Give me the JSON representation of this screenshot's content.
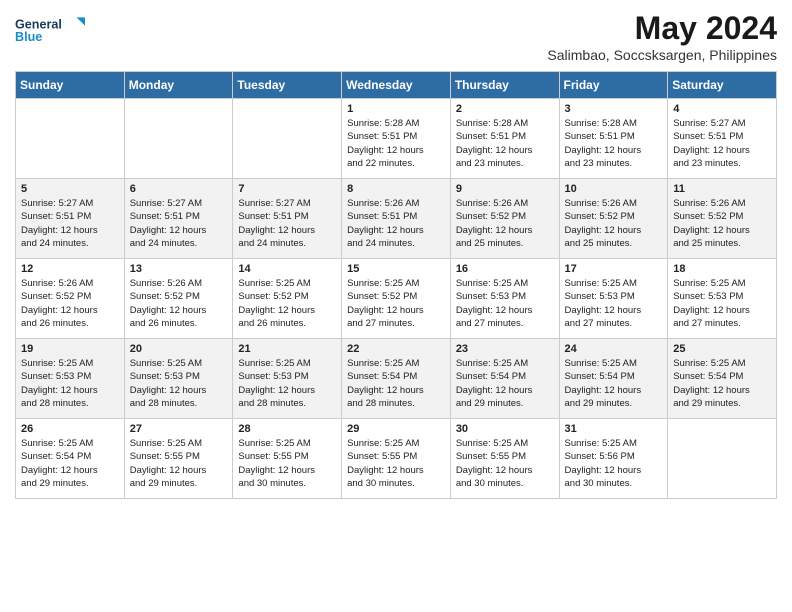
{
  "logo": {
    "line1": "General",
    "line2": "Blue"
  },
  "title": "May 2024",
  "subtitle": "Salimbao, Soccsksargen, Philippines",
  "weekdays": [
    "Sunday",
    "Monday",
    "Tuesday",
    "Wednesday",
    "Thursday",
    "Friday",
    "Saturday"
  ],
  "weeks": [
    [
      {
        "day": "",
        "info": ""
      },
      {
        "day": "",
        "info": ""
      },
      {
        "day": "",
        "info": ""
      },
      {
        "day": "1",
        "info": "Sunrise: 5:28 AM\nSunset: 5:51 PM\nDaylight: 12 hours\nand 22 minutes."
      },
      {
        "day": "2",
        "info": "Sunrise: 5:28 AM\nSunset: 5:51 PM\nDaylight: 12 hours\nand 23 minutes."
      },
      {
        "day": "3",
        "info": "Sunrise: 5:28 AM\nSunset: 5:51 PM\nDaylight: 12 hours\nand 23 minutes."
      },
      {
        "day": "4",
        "info": "Sunrise: 5:27 AM\nSunset: 5:51 PM\nDaylight: 12 hours\nand 23 minutes."
      }
    ],
    [
      {
        "day": "5",
        "info": "Sunrise: 5:27 AM\nSunset: 5:51 PM\nDaylight: 12 hours\nand 24 minutes."
      },
      {
        "day": "6",
        "info": "Sunrise: 5:27 AM\nSunset: 5:51 PM\nDaylight: 12 hours\nand 24 minutes."
      },
      {
        "day": "7",
        "info": "Sunrise: 5:27 AM\nSunset: 5:51 PM\nDaylight: 12 hours\nand 24 minutes."
      },
      {
        "day": "8",
        "info": "Sunrise: 5:26 AM\nSunset: 5:51 PM\nDaylight: 12 hours\nand 24 minutes."
      },
      {
        "day": "9",
        "info": "Sunrise: 5:26 AM\nSunset: 5:52 PM\nDaylight: 12 hours\nand 25 minutes."
      },
      {
        "day": "10",
        "info": "Sunrise: 5:26 AM\nSunset: 5:52 PM\nDaylight: 12 hours\nand 25 minutes."
      },
      {
        "day": "11",
        "info": "Sunrise: 5:26 AM\nSunset: 5:52 PM\nDaylight: 12 hours\nand 25 minutes."
      }
    ],
    [
      {
        "day": "12",
        "info": "Sunrise: 5:26 AM\nSunset: 5:52 PM\nDaylight: 12 hours\nand 26 minutes."
      },
      {
        "day": "13",
        "info": "Sunrise: 5:26 AM\nSunset: 5:52 PM\nDaylight: 12 hours\nand 26 minutes."
      },
      {
        "day": "14",
        "info": "Sunrise: 5:25 AM\nSunset: 5:52 PM\nDaylight: 12 hours\nand 26 minutes."
      },
      {
        "day": "15",
        "info": "Sunrise: 5:25 AM\nSunset: 5:52 PM\nDaylight: 12 hours\nand 27 minutes."
      },
      {
        "day": "16",
        "info": "Sunrise: 5:25 AM\nSunset: 5:53 PM\nDaylight: 12 hours\nand 27 minutes."
      },
      {
        "day": "17",
        "info": "Sunrise: 5:25 AM\nSunset: 5:53 PM\nDaylight: 12 hours\nand 27 minutes."
      },
      {
        "day": "18",
        "info": "Sunrise: 5:25 AM\nSunset: 5:53 PM\nDaylight: 12 hours\nand 27 minutes."
      }
    ],
    [
      {
        "day": "19",
        "info": "Sunrise: 5:25 AM\nSunset: 5:53 PM\nDaylight: 12 hours\nand 28 minutes."
      },
      {
        "day": "20",
        "info": "Sunrise: 5:25 AM\nSunset: 5:53 PM\nDaylight: 12 hours\nand 28 minutes."
      },
      {
        "day": "21",
        "info": "Sunrise: 5:25 AM\nSunset: 5:53 PM\nDaylight: 12 hours\nand 28 minutes."
      },
      {
        "day": "22",
        "info": "Sunrise: 5:25 AM\nSunset: 5:54 PM\nDaylight: 12 hours\nand 28 minutes."
      },
      {
        "day": "23",
        "info": "Sunrise: 5:25 AM\nSunset: 5:54 PM\nDaylight: 12 hours\nand 29 minutes."
      },
      {
        "day": "24",
        "info": "Sunrise: 5:25 AM\nSunset: 5:54 PM\nDaylight: 12 hours\nand 29 minutes."
      },
      {
        "day": "25",
        "info": "Sunrise: 5:25 AM\nSunset: 5:54 PM\nDaylight: 12 hours\nand 29 minutes."
      }
    ],
    [
      {
        "day": "26",
        "info": "Sunrise: 5:25 AM\nSunset: 5:54 PM\nDaylight: 12 hours\nand 29 minutes."
      },
      {
        "day": "27",
        "info": "Sunrise: 5:25 AM\nSunset: 5:55 PM\nDaylight: 12 hours\nand 29 minutes."
      },
      {
        "day": "28",
        "info": "Sunrise: 5:25 AM\nSunset: 5:55 PM\nDaylight: 12 hours\nand 30 minutes."
      },
      {
        "day": "29",
        "info": "Sunrise: 5:25 AM\nSunset: 5:55 PM\nDaylight: 12 hours\nand 30 minutes."
      },
      {
        "day": "30",
        "info": "Sunrise: 5:25 AM\nSunset: 5:55 PM\nDaylight: 12 hours\nand 30 minutes."
      },
      {
        "day": "31",
        "info": "Sunrise: 5:25 AM\nSunset: 5:56 PM\nDaylight: 12 hours\nand 30 minutes."
      },
      {
        "day": "",
        "info": ""
      }
    ]
  ]
}
